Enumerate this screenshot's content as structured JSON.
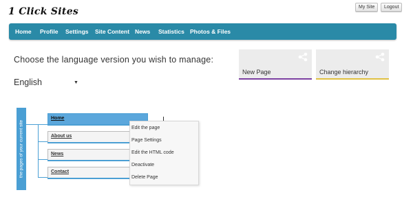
{
  "header": {
    "logo": "1 Click Sites",
    "my_site_label": "My Site",
    "logout_label": "Logout"
  },
  "nav": {
    "items": [
      {
        "label": "Home"
      },
      {
        "label": "Profile"
      },
      {
        "label": "Settings"
      },
      {
        "label": "Site Content"
      },
      {
        "label": "News"
      },
      {
        "label": "Statistics"
      },
      {
        "label": "Photos & Files"
      }
    ]
  },
  "language": {
    "prompt": "Choose the language version you wish to manage:",
    "selected": "English"
  },
  "cards": [
    {
      "label": "New Page",
      "color": "#7b3fa0",
      "icon": "share-icon"
    },
    {
      "label": "Change hierarchy",
      "color": "#e0c040",
      "icon": "share-icon"
    }
  ],
  "site_tree": {
    "sidebar_label": "the pages of your current site",
    "pages": [
      {
        "label": "Home"
      },
      {
        "label": "About us"
      },
      {
        "label": "News"
      },
      {
        "label": "Contact"
      }
    ]
  },
  "context_menu": {
    "items": [
      {
        "label": "Edit the page"
      },
      {
        "label": "Page Settings"
      },
      {
        "label": "Edit the HTML code"
      },
      {
        "label": "Deactivate"
      },
      {
        "label": "Delete Page"
      }
    ]
  },
  "colors": {
    "nav_bg": "#2a8aa7",
    "tree_blue": "#4a9fd4",
    "card_bg": "#ececec"
  }
}
